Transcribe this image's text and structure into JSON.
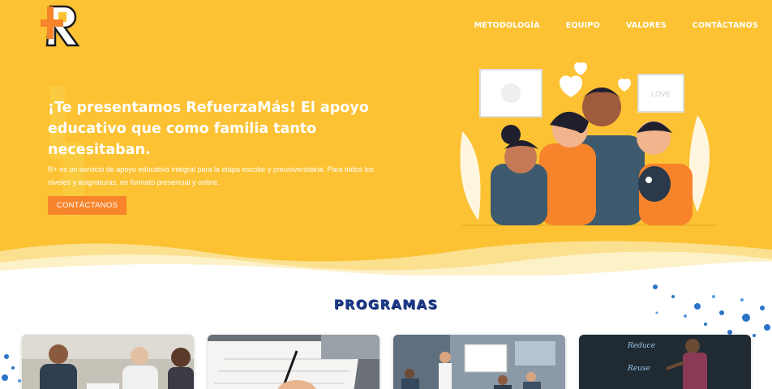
{
  "brand": {
    "name": "R+",
    "accent": "#f7842b",
    "background": "#fcc233"
  },
  "nav": {
    "items": [
      {
        "label": "METODOLOGÍA"
      },
      {
        "label": "EQUIPO"
      },
      {
        "label": "VALORES"
      },
      {
        "label": "CONTÁCTANOS"
      }
    ]
  },
  "hero": {
    "headline": "¡Te presentamos RefuerzaMás! El apoyo educativo que como familia tanto necesitaban.",
    "description": "R+ es un servicio de apoyo educativo integral para la etapa escolar y preuniversitaria. Para todos los niveles y asignaturas, en formato presencial y online.",
    "cta_label": "CONTÁCTANOS"
  },
  "illustration": {
    "frame_right_text": "LOVE"
  },
  "programs": {
    "title": "PROGRAMAS",
    "cards": [
      {
        "image": "meeting-photo"
      },
      {
        "image": "writing-photo"
      },
      {
        "image": "classroom-photo"
      },
      {
        "image": "chalkboard-photo"
      }
    ]
  }
}
